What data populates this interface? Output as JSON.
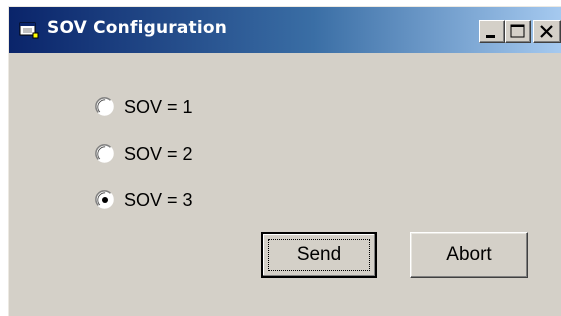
{
  "window": {
    "title": "SOV Configuration",
    "controls": {
      "minimize": "minimize-icon",
      "maximize": "maximize-icon",
      "close": "close-icon"
    }
  },
  "options": [
    {
      "label": "SOV = 1",
      "selected": false
    },
    {
      "label": "SOV = 2",
      "selected": false
    },
    {
      "label": "SOV = 3",
      "selected": true
    }
  ],
  "buttons": {
    "send_label": "Send",
    "abort_label": "Abort"
  },
  "colors": {
    "titlebar_start": "#0a246a",
    "titlebar_end": "#a6caf0",
    "window_face": "#d4d0c8"
  }
}
